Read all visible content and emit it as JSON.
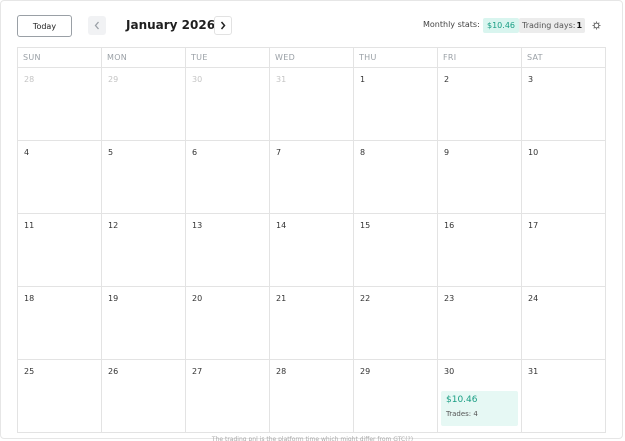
{
  "header": {
    "today_label": "Today",
    "month_title": "January 2026",
    "stats_label": "Monthly stats:",
    "stats_value": "$10.46",
    "trading_days_label": "Trading days:",
    "trading_days_value": "1"
  },
  "weekdays": [
    "SUN",
    "MON",
    "TUE",
    "WED",
    "THU",
    "FRI",
    "SAT"
  ],
  "weeks": [
    [
      {
        "day": "28",
        "muted": true
      },
      {
        "day": "29",
        "muted": true
      },
      {
        "day": "30",
        "muted": true
      },
      {
        "day": "31",
        "muted": true
      },
      {
        "day": "1"
      },
      {
        "day": "2"
      },
      {
        "day": "3"
      }
    ],
    [
      {
        "day": "4"
      },
      {
        "day": "5"
      },
      {
        "day": "6"
      },
      {
        "day": "7"
      },
      {
        "day": "8"
      },
      {
        "day": "9"
      },
      {
        "day": "10"
      }
    ],
    [
      {
        "day": "11"
      },
      {
        "day": "12"
      },
      {
        "day": "13"
      },
      {
        "day": "14"
      },
      {
        "day": "15"
      },
      {
        "day": "16"
      },
      {
        "day": "17"
      }
    ],
    [
      {
        "day": "18"
      },
      {
        "day": "19"
      },
      {
        "day": "20"
      },
      {
        "day": "21"
      },
      {
        "day": "22"
      },
      {
        "day": "23"
      },
      {
        "day": "24"
      }
    ],
    [
      {
        "day": "25"
      },
      {
        "day": "26"
      },
      {
        "day": "27"
      },
      {
        "day": "28"
      },
      {
        "day": "29"
      },
      {
        "day": "30",
        "pnl": "$10.46",
        "trades": "Trades: 4"
      },
      {
        "day": "31"
      }
    ]
  ],
  "footer_note": "The trading pnl is the platform time which might differ from GTC(?)",
  "colors": {
    "accent": "#1a9e84",
    "accent_bg": "#d9f5ef"
  },
  "icons": {
    "prev": "chevron-left-icon",
    "next": "chevron-right-icon",
    "settings": "gear-icon"
  }
}
